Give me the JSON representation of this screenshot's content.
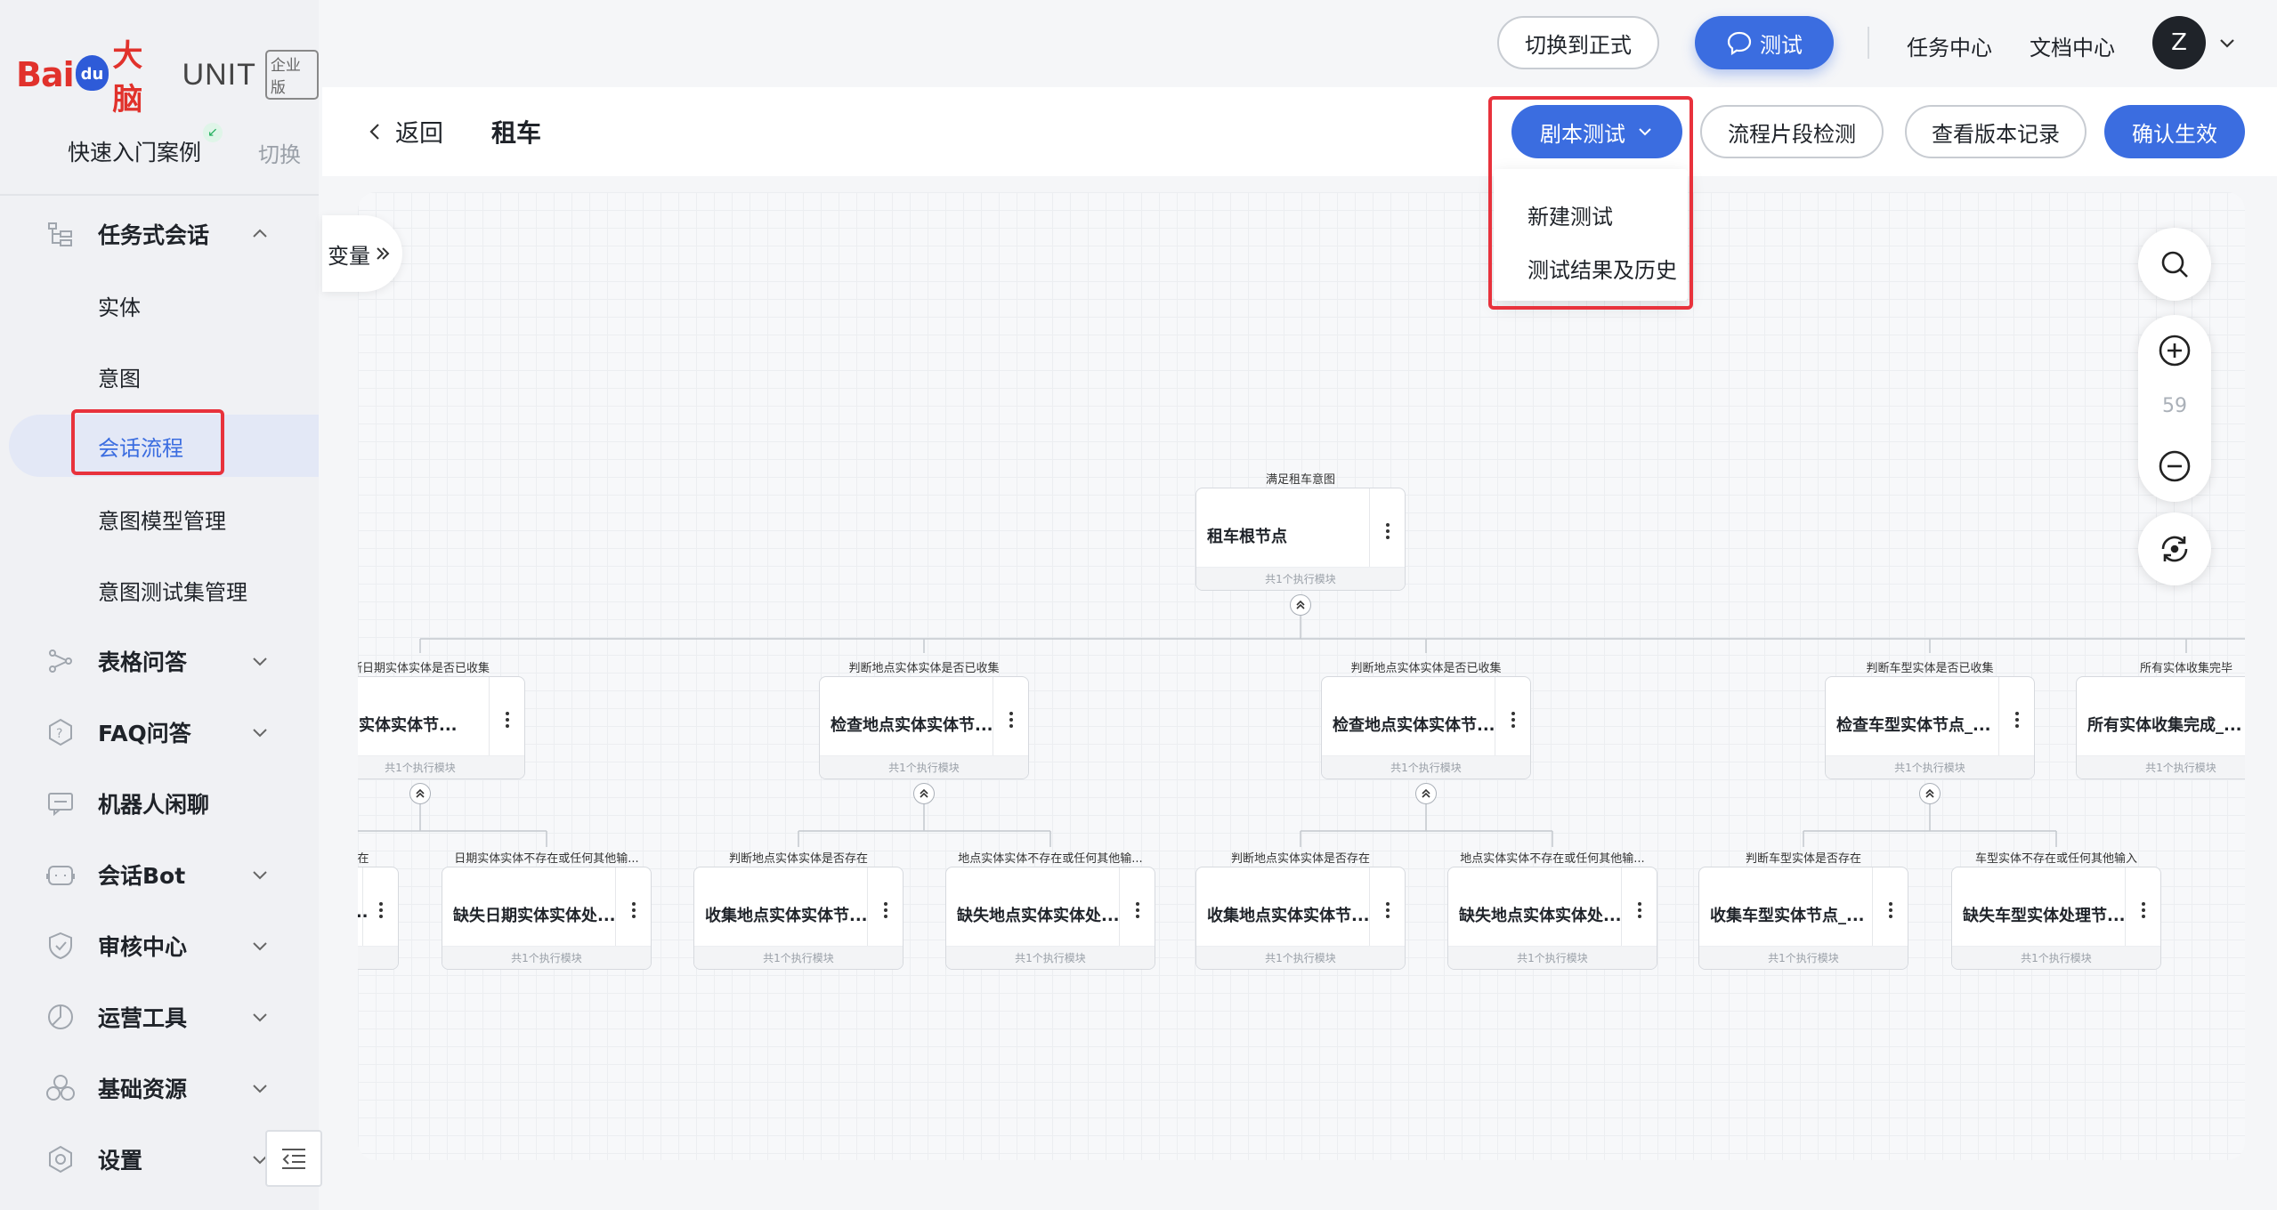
{
  "brand": {
    "logo_bai": "Bai",
    "logo_du": "du",
    "logo_danao": "大脑",
    "logo_unit": "UNIT",
    "logo_badge": "企业版"
  },
  "sidebar": {
    "quick_start": "快速入门案例",
    "switch_label": "切换",
    "items": [
      {
        "label": "任务式会话",
        "icon": "task-tree-icon",
        "expanded": true
      },
      {
        "label": "表格问答",
        "icon": "table-qa-icon"
      },
      {
        "label": "FAQ问答",
        "icon": "faq-icon"
      },
      {
        "label": "机器人闲聊",
        "icon": "chat-icon"
      },
      {
        "label": "会话Bot",
        "icon": "bot-icon"
      },
      {
        "label": "审核中心",
        "icon": "shield-icon"
      },
      {
        "label": "运营工具",
        "icon": "ops-icon"
      },
      {
        "label": "基础资源",
        "icon": "resource-icon"
      },
      {
        "label": "设置",
        "icon": "settings-icon"
      }
    ],
    "sub_items": [
      "实体",
      "意图",
      "会话流程",
      "意图模型管理",
      "意图测试集管理"
    ],
    "active_sub": "会话流程"
  },
  "topbar": {
    "switch_formal": "切换到正式",
    "test": "测试",
    "task_center": "任务中心",
    "doc_center": "文档中心",
    "avatar_initial": "Z"
  },
  "header": {
    "back": "返回",
    "title": "租车",
    "script_test": "剧本测试",
    "fragment_check": "流程片段检测",
    "version_history": "查看版本记录",
    "confirm": "确认生效",
    "dropdown": [
      "新建测试",
      "测试结果及历史"
    ]
  },
  "canvas": {
    "variable_tab": "变量",
    "zoom": "59",
    "footer_label": "共1个执行模块",
    "root": {
      "caption": "满足租车意图",
      "title": "租车根节点"
    },
    "level1": [
      {
        "caption": "断日期实体实体是否已收集",
        "title": "日期实体实体节..."
      },
      {
        "caption": "判断地点实体实体是否已收集",
        "title": "检查地点实体实体节..."
      },
      {
        "caption": "判断地点实体实体是否已收集",
        "title": "检查地点实体实体节..."
      },
      {
        "caption": "判断车型实体是否已收集",
        "title": "检查车型实体节点_..."
      },
      {
        "caption": "所有实体收集完毕",
        "title": "所有实体收集完成_..."
      }
    ],
    "level2": [
      {
        "caption": "在",
        "title": "..."
      },
      {
        "caption": "日期实体实体不存在或任何其他输...",
        "title": "缺失日期实体实体处..."
      },
      {
        "caption": "判断地点实体实体是否存在",
        "title": "收集地点实体实体节..."
      },
      {
        "caption": "地点实体实体不存在或任何其他输...",
        "title": "缺失地点实体实体处..."
      },
      {
        "caption": "判断地点实体实体是否存在",
        "title": "收集地点实体实体节..."
      },
      {
        "caption": "地点实体实体不存在或任何其他输...",
        "title": "缺失地点实体实体处..."
      },
      {
        "caption": "判断车型实体是否存在",
        "title": "收集车型实体节点_..."
      },
      {
        "caption": "车型实体不存在或任何其他输入",
        "title": "缺失车型实体处理节..."
      }
    ]
  },
  "colors": {
    "accent": "#3b6de0",
    "highlight": "#e8323c",
    "brand_red": "#e1322c"
  }
}
